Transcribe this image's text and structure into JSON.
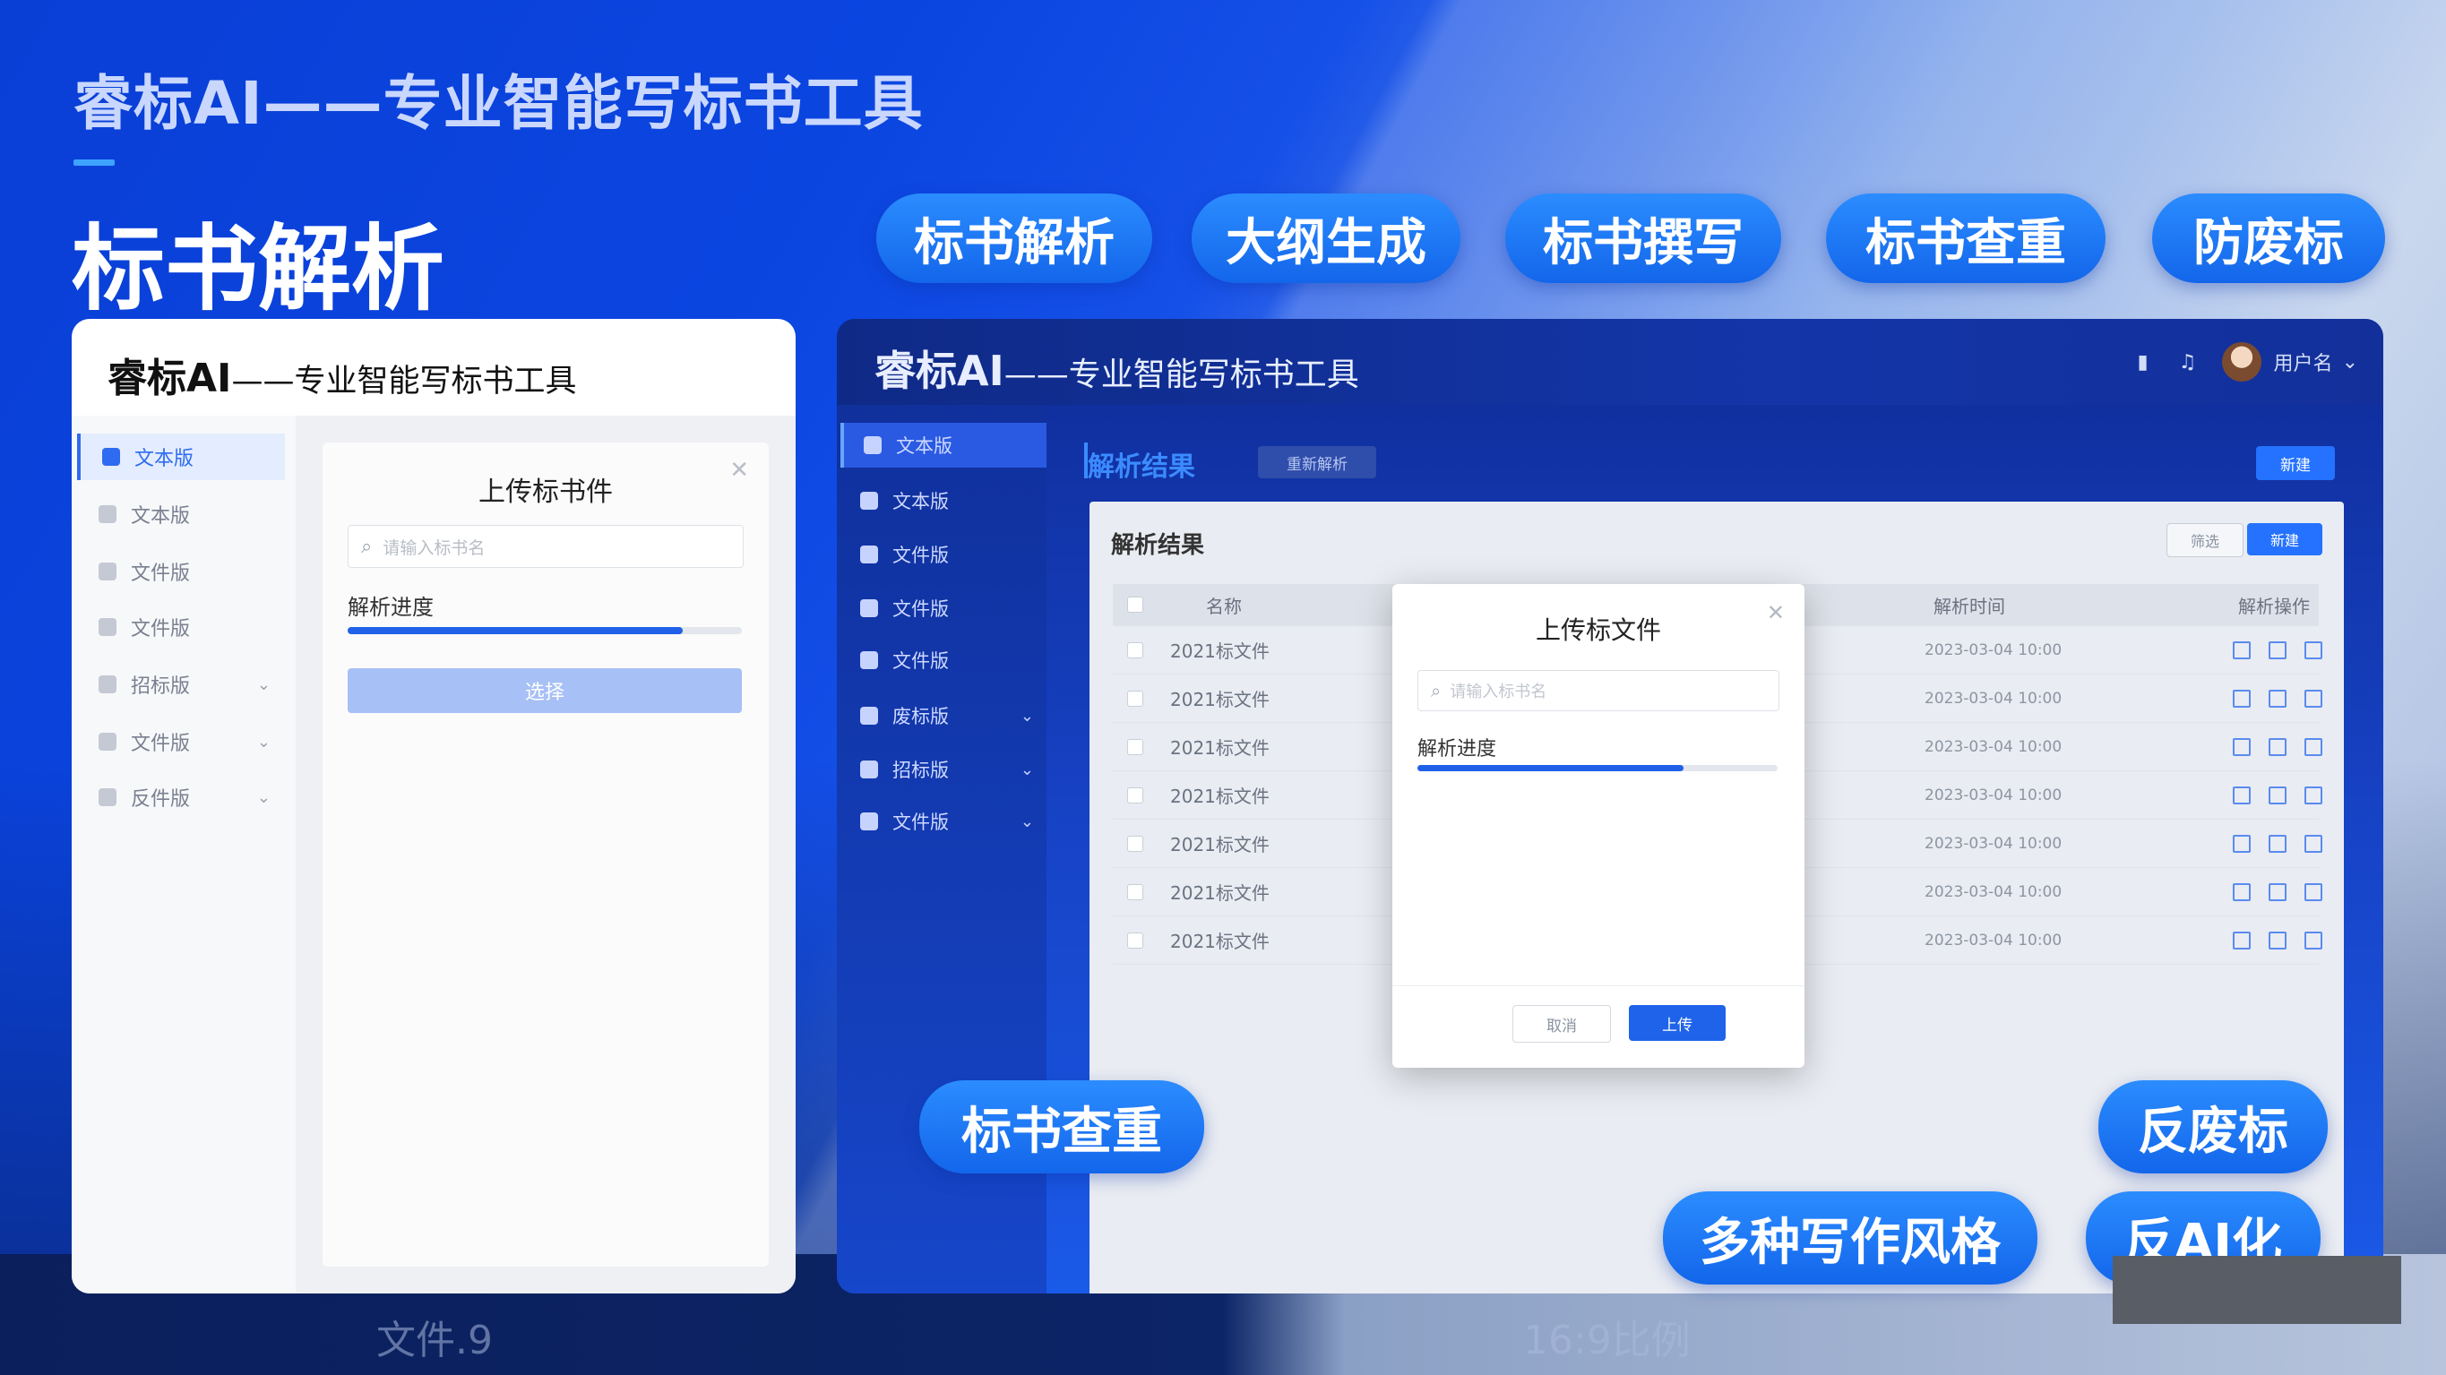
{
  "header": {
    "subtitle": "睿标AI——专业智能写标书工具",
    "title": "标书解析"
  },
  "feature_pills": [
    "标书解析",
    "大纲生成",
    "标书撰写",
    "标书查重",
    "防废标"
  ],
  "overlay_pills": {
    "check": "标书查重",
    "anti_waste": "反废标",
    "styles": "多种写作风格",
    "anti_ai": "反AI化"
  },
  "left_app": {
    "brand": "睿标AI",
    "brand_suffix": "——专业智能写标书工具",
    "sidebar": [
      {
        "label": "文本版",
        "active": true,
        "chevron": false
      },
      {
        "label": "文本版",
        "active": false,
        "chevron": false
      },
      {
        "label": "文件版",
        "active": false,
        "chevron": false
      },
      {
        "label": "文件版",
        "active": false,
        "chevron": false
      },
      {
        "label": "招标版",
        "active": false,
        "chevron": true
      },
      {
        "label": "文件版",
        "active": false,
        "chevron": true
      },
      {
        "label": "反件版",
        "active": false,
        "chevron": true
      }
    ],
    "dialog": {
      "title": "上传标书件",
      "search_placeholder": "请输入标书名",
      "progress_label": "解析进度",
      "progress": 0.85,
      "button": "选择"
    }
  },
  "right_app": {
    "brand": "睿标AI",
    "brand_suffix": "——专业智能写标书工具",
    "user_name": "用户名",
    "sidebar": [
      {
        "label": "文本版",
        "active": true,
        "chevron": false
      },
      {
        "label": "文本版",
        "active": false,
        "chevron": false
      },
      {
        "label": "文件版",
        "active": false,
        "chevron": false
      },
      {
        "label": "文件版",
        "active": false,
        "chevron": false
      },
      {
        "label": "文件版",
        "active": false,
        "chevron": false
      },
      {
        "label": "废标版",
        "active": false,
        "chevron": true
      },
      {
        "label": "招标版",
        "active": false,
        "chevron": true
      },
      {
        "label": "文件版",
        "active": false,
        "chevron": true
      }
    ],
    "breadcrumb": "解析结果",
    "breadcrumb_tag": "重新解析",
    "top_button": "新建",
    "panel_title": "解析结果",
    "panel_btn_secondary": "筛选",
    "panel_btn_primary": "新建",
    "table": {
      "headers": [
        "名称",
        "解析时间",
        "解析操作"
      ],
      "rows": [
        {
          "name": "2021标文件",
          "time": "2023-03-04 10:00"
        },
        {
          "name": "2021标文件",
          "time": "2023-03-04 10:00"
        },
        {
          "name": "2021标文件",
          "time": "2023-03-04 10:00"
        },
        {
          "name": "2021标文件",
          "time": "2023-03-04 10:00"
        },
        {
          "name": "2021标文件",
          "time": "2023-03-04 10:00"
        },
        {
          "name": "2021标文件",
          "time": "2023-03-04 10:00"
        },
        {
          "name": "2021标文件",
          "time": "2023-03-04 10:00"
        }
      ]
    },
    "modal": {
      "title": "上传标文件",
      "search_placeholder": "请输入标书名",
      "progress_label": "解析进度",
      "progress": 0.74,
      "cancel": "取消",
      "upload": "上传"
    }
  },
  "captions": {
    "left": "文件.9",
    "right": "16:9比例"
  }
}
